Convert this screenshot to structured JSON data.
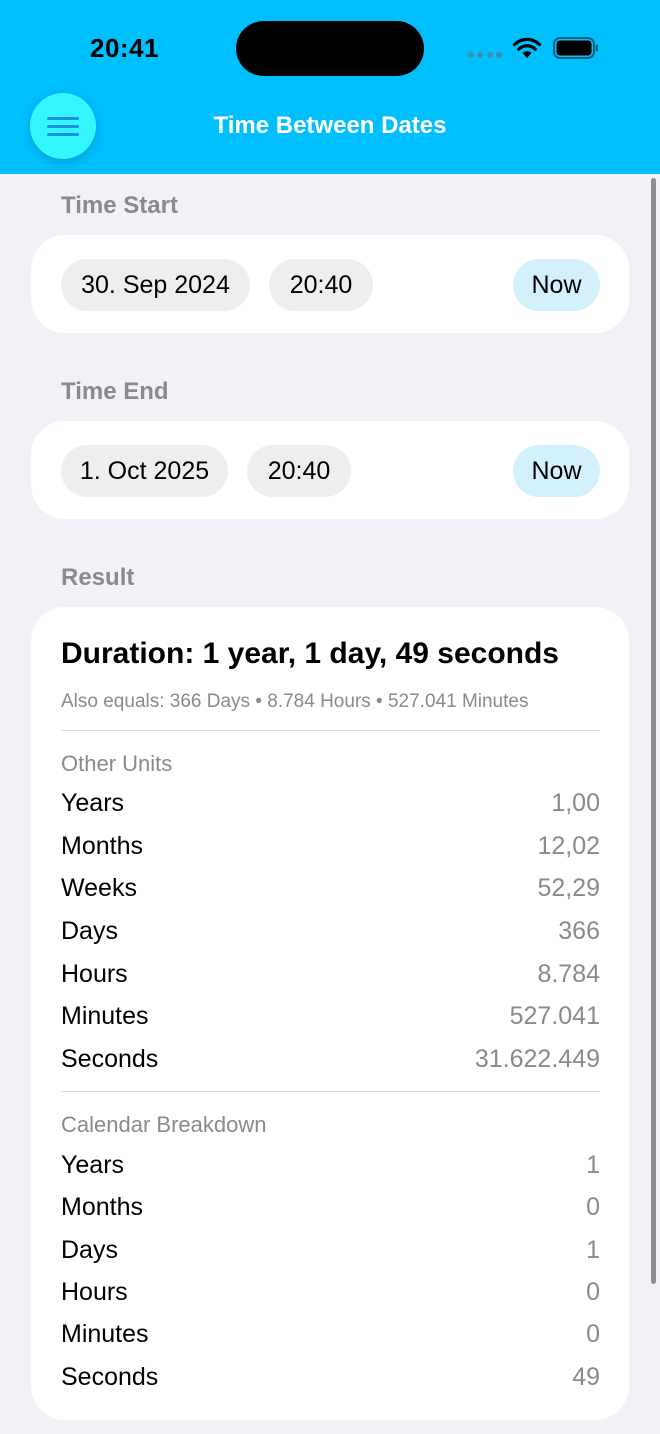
{
  "status_bar": {
    "time": "20:41"
  },
  "header": {
    "title": "Time Between Dates"
  },
  "time_start": {
    "label": "Time Start",
    "date": "30. Sep 2024",
    "time": "20:40",
    "now_label": "Now"
  },
  "time_end": {
    "label": "Time End",
    "date": "1. Oct 2025",
    "time": "20:40",
    "now_label": "Now"
  },
  "result": {
    "label": "Result",
    "duration": "Duration: 1 year, 1 day, 49 seconds",
    "also_equals": "Also equals: 366 Days • 8.784 Hours • 527.041 Minutes",
    "other_units": {
      "label": "Other Units",
      "rows": [
        {
          "label": "Years",
          "value": "1,00"
        },
        {
          "label": "Months",
          "value": "12,02"
        },
        {
          "label": "Weeks",
          "value": "52,29"
        },
        {
          "label": "Days",
          "value": "366"
        },
        {
          "label": "Hours",
          "value": "8.784"
        },
        {
          "label": "Minutes",
          "value": "527.041"
        },
        {
          "label": "Seconds",
          "value": "31.622.449"
        }
      ]
    },
    "calendar_breakdown": {
      "label": "Calendar Breakdown",
      "rows": [
        {
          "label": "Years",
          "value": "1"
        },
        {
          "label": "Months",
          "value": "0"
        },
        {
          "label": "Days",
          "value": "1"
        },
        {
          "label": "Hours",
          "value": "0"
        },
        {
          "label": "Minutes",
          "value": "0"
        },
        {
          "label": "Seconds",
          "value": "49"
        }
      ]
    }
  },
  "colors": {
    "header_bg": "#00bfff",
    "menu_button_bg": "#33f6ff",
    "now_pill_bg": "#d3f1fd",
    "page_bg": "#f2f1f7"
  },
  "icons": {
    "menu": "hamburger-menu-icon",
    "wifi": "wifi-icon",
    "battery": "battery-icon"
  }
}
